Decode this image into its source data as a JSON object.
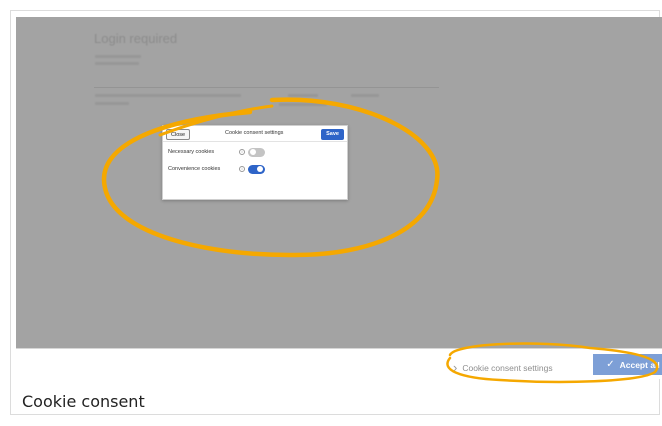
{
  "page": {
    "title": "Login required",
    "caption": "Cookie consent"
  },
  "dialog": {
    "close_label": "Close",
    "title": "Cookie consent settings",
    "save_label": "Save",
    "rows": [
      {
        "label": "Necessary cookies",
        "enabled": false
      },
      {
        "label": "Convenience cookies",
        "enabled": true
      }
    ]
  },
  "footer": {
    "settings_label": "Cookie consent settings",
    "accept_label": "Accept all"
  },
  "colors": {
    "accent": "#2e64c8",
    "annotation": "#f5a800",
    "overlay": "#a3a3a3"
  },
  "icons": {
    "info": "info-icon",
    "chevron": "chevron-right-icon",
    "check": "check-icon"
  }
}
